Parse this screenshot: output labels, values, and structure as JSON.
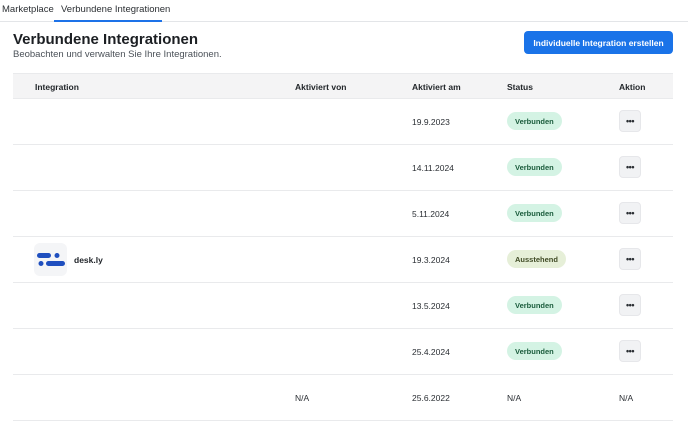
{
  "tabs": [
    {
      "label": "Marketplace"
    },
    {
      "label": "Verbundene Integrationen"
    }
  ],
  "header": {
    "title": "Verbundene Integrationen",
    "subtitle": "Beobachten und verwalten Sie Ihre Integrationen.",
    "create_button": "Individuelle Integration erstellen"
  },
  "table": {
    "columns": [
      "Integration",
      "Aktiviert von",
      "Aktiviert am",
      "Status",
      "Aktion"
    ],
    "rows": [
      {
        "integration": "",
        "activated_by": "",
        "date": "19.9.2023",
        "status": "Verbunden",
        "action": "•••"
      },
      {
        "integration": "",
        "activated_by": "",
        "date": "14.11.2024",
        "status": "Verbunden",
        "action": "•••"
      },
      {
        "integration": "",
        "activated_by": "",
        "date": "5.11.2024",
        "status": "Verbunden",
        "action": "•••"
      },
      {
        "integration": "desk.ly",
        "activated_by": "",
        "date": "19.3.2024",
        "status": "Ausstehend",
        "action": "•••"
      },
      {
        "integration": "",
        "activated_by": "",
        "date": "13.5.2024",
        "status": "Verbunden",
        "action": "•••"
      },
      {
        "integration": "",
        "activated_by": "",
        "date": "25.4.2024",
        "status": "Verbunden",
        "action": "•••"
      },
      {
        "integration": "",
        "activated_by": "N/A",
        "date": "25.6.2022",
        "status": "N/A",
        "action": "N/A"
      }
    ]
  },
  "colors": {
    "accent": "#1a73e8",
    "badge_connected_bg": "#d4f3e4",
    "badge_pending_bg": "#e6efd8",
    "logo_blue": "#1f4fbf"
  },
  "icons": {
    "row_menu": "more-horizontal-icon",
    "desk_logo": "deskly-logo-icon"
  }
}
